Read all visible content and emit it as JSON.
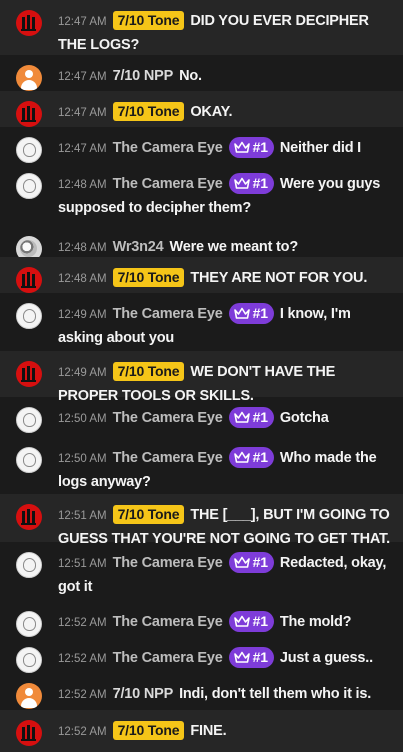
{
  "messages": [
    {
      "type": "red",
      "time": "12:47 AM",
      "name": "",
      "tag": "7/10 Tone",
      "rank": "",
      "text": "DID YOU EVER DECIPHER THE LOGS?"
    },
    {
      "type": "orange",
      "time": "12:47 AM",
      "name": "7/10 NPP",
      "tag": "",
      "rank": "",
      "text": "No."
    },
    {
      "type": "red",
      "time": "12:47 AM",
      "name": "",
      "tag": "7/10 Tone",
      "rank": "",
      "text": "OKAY."
    },
    {
      "type": "white",
      "time": "12:47 AM",
      "name": "The Camera Eye",
      "tag": "",
      "rank": "#1",
      "text": "Neither did I"
    },
    {
      "type": "white",
      "time": "12:48 AM",
      "name": "The Camera Eye",
      "tag": "",
      "rank": "#1",
      "text": "Were you guys supposed to decipher them?"
    },
    {
      "type": "gray",
      "time": "12:48 AM",
      "name": "Wr3n24",
      "tag": "",
      "rank": "",
      "text": "Were we meant to?"
    },
    {
      "type": "red",
      "time": "12:48 AM",
      "name": "",
      "tag": "7/10 Tone",
      "rank": "",
      "text": "THEY ARE NOT FOR YOU."
    },
    {
      "type": "white",
      "time": "12:49 AM",
      "name": "The Camera Eye",
      "tag": "",
      "rank": "#1",
      "text": "I know, I'm asking about you"
    },
    {
      "type": "red",
      "time": "12:49 AM",
      "name": "",
      "tag": "7/10 Tone",
      "rank": "",
      "text": "WE DON'T HAVE THE PROPER TOOLS OR SKILLS."
    },
    {
      "type": "white",
      "time": "12:50 AM",
      "name": "The Camera Eye",
      "tag": "",
      "rank": "#1",
      "text": "Gotcha"
    },
    {
      "type": "white",
      "time": "12:50 AM",
      "name": "The Camera Eye",
      "tag": "",
      "rank": "#1",
      "text": "Who made the logs anyway?"
    },
    {
      "type": "red",
      "time": "12:51 AM",
      "name": "",
      "tag": "7/10 Tone",
      "rank": "",
      "text": "THE [___], BUT I'M GOING TO GUESS THAT YOU'RE NOT GOING TO GET THAT."
    },
    {
      "type": "white",
      "time": "12:51 AM",
      "name": "The Camera Eye",
      "tag": "",
      "rank": "#1",
      "text": "Redacted, okay, got it"
    },
    {
      "type": "white",
      "time": "12:52 AM",
      "name": "The Camera Eye",
      "tag": "",
      "rank": "#1",
      "text": "The mold?"
    },
    {
      "type": "white",
      "time": "12:52 AM",
      "name": "The Camera Eye",
      "tag": "",
      "rank": "#1",
      "text": "Just a guess.."
    },
    {
      "type": "orange",
      "time": "12:52 AM",
      "name": "7/10 NPP",
      "tag": "",
      "rank": "",
      "text": "Indi, don't tell them who it is."
    },
    {
      "type": "red",
      "time": "12:52 AM",
      "name": "",
      "tag": "7/10 Tone",
      "rank": "",
      "text": "FINE."
    }
  ],
  "colors": {
    "tag": "#f5c518",
    "rank": "#7e3cd9",
    "highlight_row": "#262626",
    "background": "#1b1b1b"
  }
}
